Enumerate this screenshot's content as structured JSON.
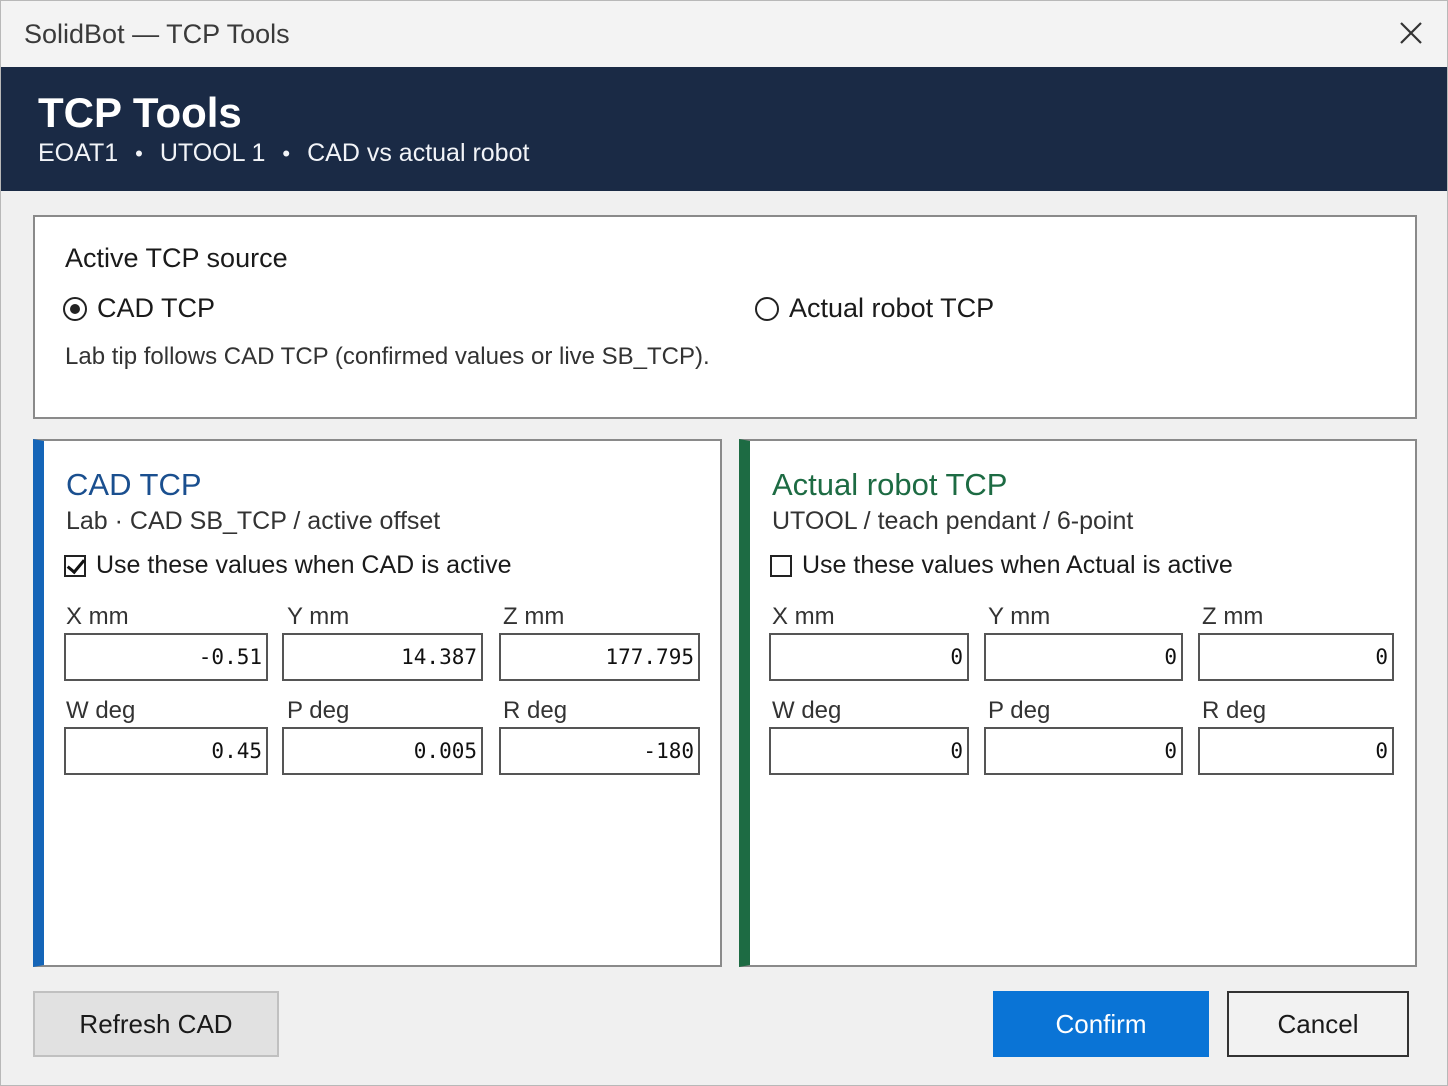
{
  "window": {
    "title": "SolidBot — TCP Tools"
  },
  "banner": {
    "title": "TCP Tools",
    "crumbs": [
      "EOAT1",
      "UTOOL 1",
      "CAD vs actual robot"
    ],
    "separator": "•"
  },
  "source": {
    "label": "Active TCP source",
    "options": [
      {
        "label": "CAD TCP",
        "selected": true
      },
      {
        "label": "Actual robot TCP",
        "selected": false
      }
    ],
    "hint": "Lab tip follows CAD TCP (confirmed values or live SB_TCP)."
  },
  "cad_panel": {
    "title": "CAD TCP",
    "subtitle": "Lab · CAD SB_TCP / active offset",
    "checkbox_label": "Use these values when CAD is active",
    "checked": true,
    "fields": [
      {
        "label": "X mm",
        "value": "-0.51"
      },
      {
        "label": "Y mm",
        "value": "14.387"
      },
      {
        "label": "Z mm",
        "value": "177.795"
      },
      {
        "label": "W deg",
        "value": "0.45"
      },
      {
        "label": "P deg",
        "value": "0.005"
      },
      {
        "label": "R deg",
        "value": "-180"
      }
    ]
  },
  "actual_panel": {
    "title": "Actual robot TCP",
    "subtitle": "UTOOL / teach pendant / 6-point",
    "checkbox_label": "Use these values when Actual is active",
    "checked": false,
    "fields": [
      {
        "label": "X mm",
        "value": "0"
      },
      {
        "label": "Y mm",
        "value": "0"
      },
      {
        "label": "Z mm",
        "value": "0"
      },
      {
        "label": "W deg",
        "value": "0"
      },
      {
        "label": "P deg",
        "value": "0"
      },
      {
        "label": "R deg",
        "value": "0"
      }
    ]
  },
  "buttons": {
    "refresh": "Refresh CAD",
    "confirm": "Confirm",
    "cancel": "Cancel"
  },
  "colors": {
    "banner": "#1a2a45",
    "cad_accent": "#1565b8",
    "actual_accent": "#1d6b43",
    "primary_button": "#0a74d6"
  }
}
